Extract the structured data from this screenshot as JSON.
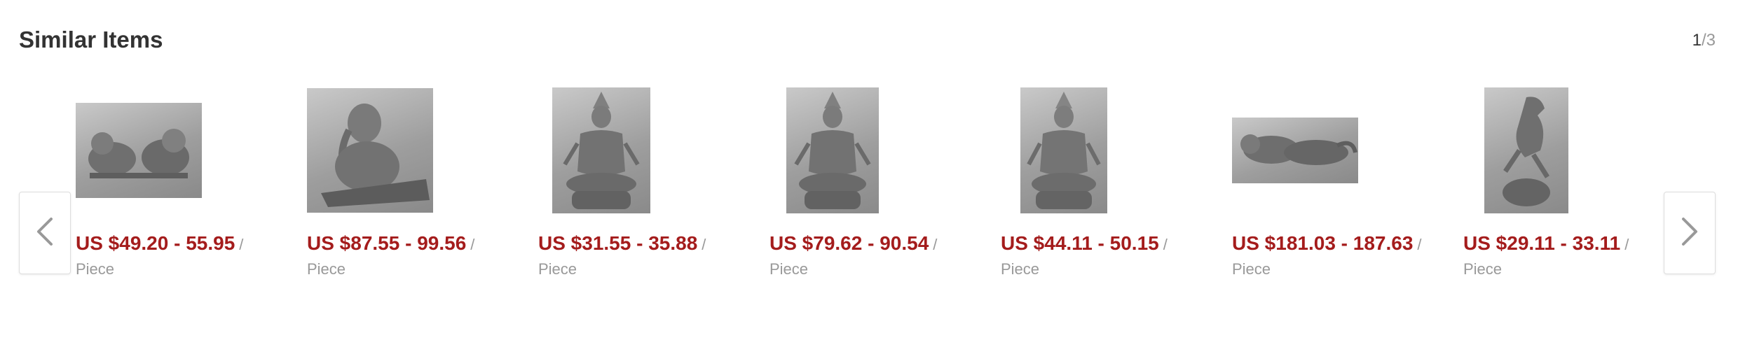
{
  "header": {
    "title": "Similar Items"
  },
  "pager": {
    "current": "1",
    "separator": "/",
    "total": "3"
  },
  "nav": {
    "prev_icon": "chevron-left-icon",
    "next_icon": "chevron-right-icon"
  },
  "items": [
    {
      "image": "pixiu-pair-statue-image",
      "price": "US $49.20 - 55.95",
      "slash": "/",
      "unit": "Piece"
    },
    {
      "image": "ganesha-statue-image",
      "price": "US $87.55 - 99.56",
      "slash": "/",
      "unit": "Piece"
    },
    {
      "image": "guanyin-statue-image",
      "price": "US $31.55 - 35.88",
      "slash": "/",
      "unit": "Piece"
    },
    {
      "image": "guanyin-statue-image",
      "price": "US $79.62 - 90.54",
      "slash": "/",
      "unit": "Piece"
    },
    {
      "image": "guanyin-statue-image",
      "price": "US $44.11 - 50.15",
      "slash": "/",
      "unit": "Piece"
    },
    {
      "image": "dragon-beast-statue-image",
      "price": "US $181.03 - 187.63",
      "slash": "/",
      "unit": "Piece"
    },
    {
      "image": "horse-statue-image",
      "price": "US $29.11 - 33.11",
      "slash": "/",
      "unit": "Piece"
    }
  ]
}
